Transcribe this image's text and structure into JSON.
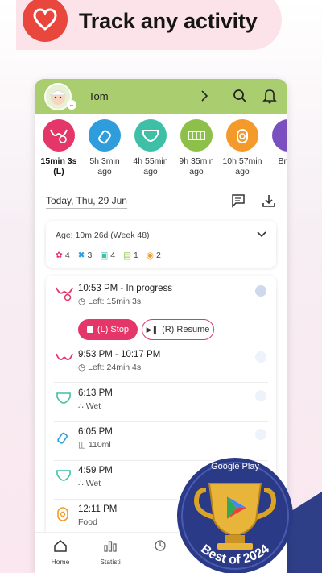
{
  "banner": {
    "title": "Track any activity",
    "icon": "heart-icon"
  },
  "header": {
    "username": "Tom"
  },
  "quick_actions": [
    {
      "icon": "breastfeeding-icon",
      "label": "15min 3s (L)",
      "bold": true,
      "color": "#e5366a"
    },
    {
      "icon": "bottle-icon",
      "label": "5h 3min ago",
      "bold": false,
      "color": "#2f9cdc"
    },
    {
      "icon": "diaper-icon",
      "label": "4h 55min ago",
      "bold": false,
      "color": "#3fbfa6"
    },
    {
      "icon": "crib-icon",
      "label": "9h 35min ago",
      "bold": false,
      "color": "#8cc04a"
    },
    {
      "icon": "food-icon",
      "label": "10h 57min ago",
      "bold": false,
      "color": "#f39a2a"
    },
    {
      "icon": "pump-icon",
      "label": "Br pu",
      "bold": false,
      "color": "#7a4fbf"
    }
  ],
  "date": {
    "label": "Today, Thu, 29 Jun"
  },
  "summary": {
    "age": "Age: 10m 26d (Week 48)",
    "counts": [
      {
        "icon": "breastfeeding-icon",
        "value": "4",
        "color": "#e5366a"
      },
      {
        "icon": "bottle-icon",
        "value": "3",
        "color": "#2f9cdc"
      },
      {
        "icon": "diaper-icon",
        "value": "4",
        "color": "#3fbfa6"
      },
      {
        "icon": "crib-icon",
        "value": "1",
        "color": "#8cc04a"
      },
      {
        "icon": "food-icon",
        "value": "2",
        "color": "#f39a2a"
      }
    ]
  },
  "entries": [
    {
      "icon": "breastfeeding-icon",
      "time": "10:53 PM - In progress",
      "sub": "Left: 15min 3s",
      "sub_icon": "timer-icon",
      "color": "#e5366a"
    },
    {
      "icon": "breastfeeding-icon",
      "time": "9:53 PM - 10:17 PM",
      "sub": "Left: 24min 4s",
      "sub_icon": "timer-icon",
      "color": "#e5366a"
    },
    {
      "icon": "diaper-icon",
      "time": "6:13 PM",
      "sub": "Wet",
      "sub_icon": "drops-icon",
      "color": "#3fbfa6"
    },
    {
      "icon": "bottle-icon",
      "time": "6:05 PM",
      "sub": "110ml",
      "sub_icon": "cup-icon",
      "color": "#2f9cdc"
    },
    {
      "icon": "diaper-icon",
      "time": "4:59 PM",
      "sub": "Wet",
      "sub_icon": "drops-icon",
      "color": "#3fbfa6"
    },
    {
      "icon": "food-icon",
      "time": "12:11 PM",
      "sub": "Food",
      "sub_icon": "",
      "color": "#f39a2a"
    }
  ],
  "buttons": {
    "stop": "(L) Stop",
    "resume": "(R) Resume"
  },
  "nav": {
    "home": "Home",
    "statistics": "Statisti"
  },
  "badge": {
    "top": "Google Play",
    "bottom": "Best of 2024"
  },
  "colors": {
    "accent": "#e5366a",
    "appbar": "#a9cd6f",
    "banner_red": "#e9463d"
  }
}
